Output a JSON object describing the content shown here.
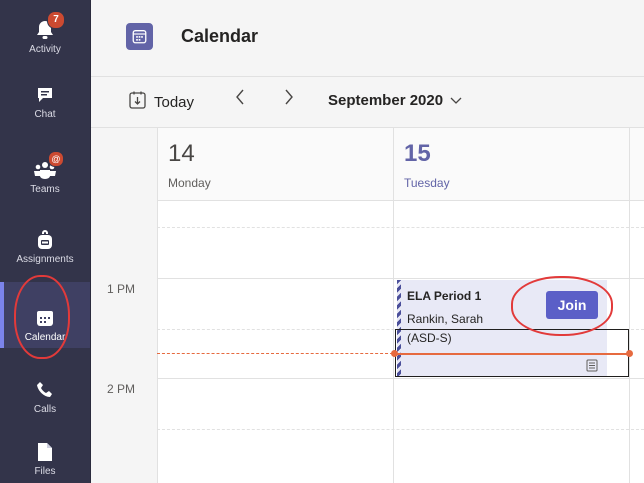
{
  "rail": {
    "items": [
      {
        "label": "Activity",
        "icon": "bell-icon",
        "badge": "7"
      },
      {
        "label": "Chat",
        "icon": "chat-icon"
      },
      {
        "label": "Teams",
        "icon": "teams-icon",
        "badge": "@"
      },
      {
        "label": "Assignments",
        "icon": "backpack-icon"
      },
      {
        "label": "Calendar",
        "icon": "calendar-icon"
      },
      {
        "label": "Calls",
        "icon": "phone-icon"
      },
      {
        "label": "Files",
        "icon": "file-icon"
      }
    ],
    "active": "Calendar"
  },
  "header": {
    "title": "Calendar",
    "icon": "calendar-icon"
  },
  "toolbar": {
    "today_label": "Today",
    "prev_icon": "chevron-left-icon",
    "next_icon": "chevron-right-icon",
    "month_label": "September 2020",
    "month_chevron": "chevron-down-icon"
  },
  "days": [
    {
      "number": "14",
      "name": "Monday",
      "is_today": false
    },
    {
      "number": "15",
      "name": "Tuesday",
      "is_today": true
    }
  ],
  "times": [
    "1 PM",
    "2 PM"
  ],
  "event": {
    "title": "ELA Period 1",
    "organizer": "Rankin, Sarah",
    "organizer_detail": "(ASD-S)",
    "join_label": "Join",
    "note_icon": "meeting-notes-icon"
  },
  "colors": {
    "rail_bg": "#33344a",
    "accent": "#6264a7",
    "join_button": "#5b5fc7",
    "current_time": "#e66a3f",
    "annotation": "#e23a3a"
  }
}
